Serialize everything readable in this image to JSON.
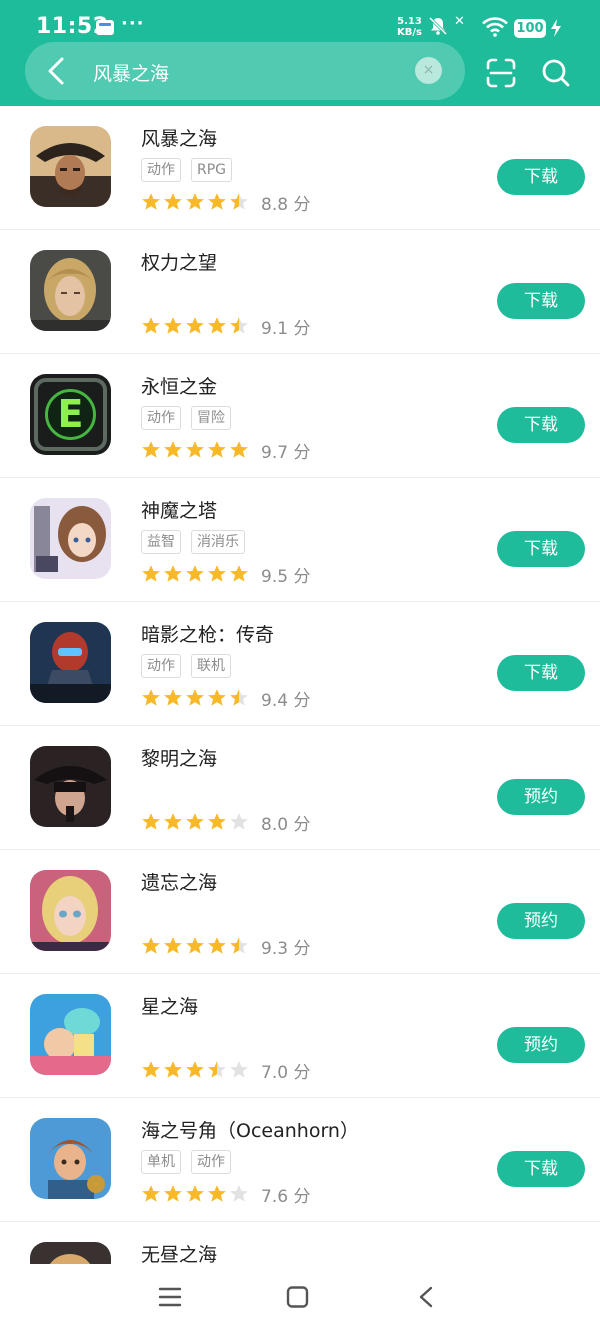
{
  "status_bar": {
    "time": "11:52",
    "dots": "···",
    "speed_top": "5.13",
    "speed_unit": "KB/s",
    "battery": "100"
  },
  "search": {
    "query": "风暴之海",
    "clear_symbol": "×"
  },
  "colors": {
    "accent": "#1fbc9c",
    "star_filled": "#f7b928",
    "star_empty": "#e2e2e2",
    "tag_text": "#8c8c8c"
  },
  "apps": [
    {
      "name": "风暴之海",
      "tags": [
        "动作",
        "RPG"
      ],
      "rating": 4.5,
      "score_label": "8.8 分",
      "action": "下载",
      "icon": "pirate-captain-icon"
    },
    {
      "name": "权力之望",
      "tags": [],
      "rating": 4.5,
      "score_label": "9.1 分",
      "action": "下载",
      "icon": "blonde-warrior-icon"
    },
    {
      "name": "永恒之金",
      "tags": [
        "动作",
        "冒险"
      ],
      "rating": 5,
      "score_label": "9.7 分",
      "action": "下载",
      "icon": "emerald-emblem-icon"
    },
    {
      "name": "神魔之塔",
      "tags": [
        "益智",
        "消消乐"
      ],
      "rating": 5,
      "score_label": "9.5 分",
      "action": "下载",
      "icon": "anime-girl-icon"
    },
    {
      "name": "暗影之枪：传奇",
      "tags": [
        "动作",
        "联机"
      ],
      "rating": 4.5,
      "score_label": "9.4 分",
      "action": "下载",
      "icon": "shadowgun-soldier-icon"
    },
    {
      "name": " 黎明之海",
      "tags": [],
      "rating": 4,
      "score_label": "8.0 分",
      "action": "预约",
      "icon": "hooded-figure-icon"
    },
    {
      "name": "遗忘之海",
      "tags": [],
      "rating": 4.5,
      "score_label": "9.3 分",
      "action": "预约",
      "icon": "doll-girl-icon"
    },
    {
      "name": "星之海",
      "tags": [],
      "rating": 3.5,
      "score_label": "7.0 分",
      "action": "预约",
      "icon": "pixel-heroes-icon"
    },
    {
      "name": "海之号角（Oceanhorn）",
      "tags": [
        "单机",
        "动作"
      ],
      "rating": 4,
      "score_label": "7.6 分",
      "action": "下载",
      "icon": "young-hero-icon"
    },
    {
      "name": "无昼之海",
      "tags": [],
      "rating": null,
      "score_label": "",
      "action": "",
      "icon": "blond-character-icon"
    }
  ]
}
